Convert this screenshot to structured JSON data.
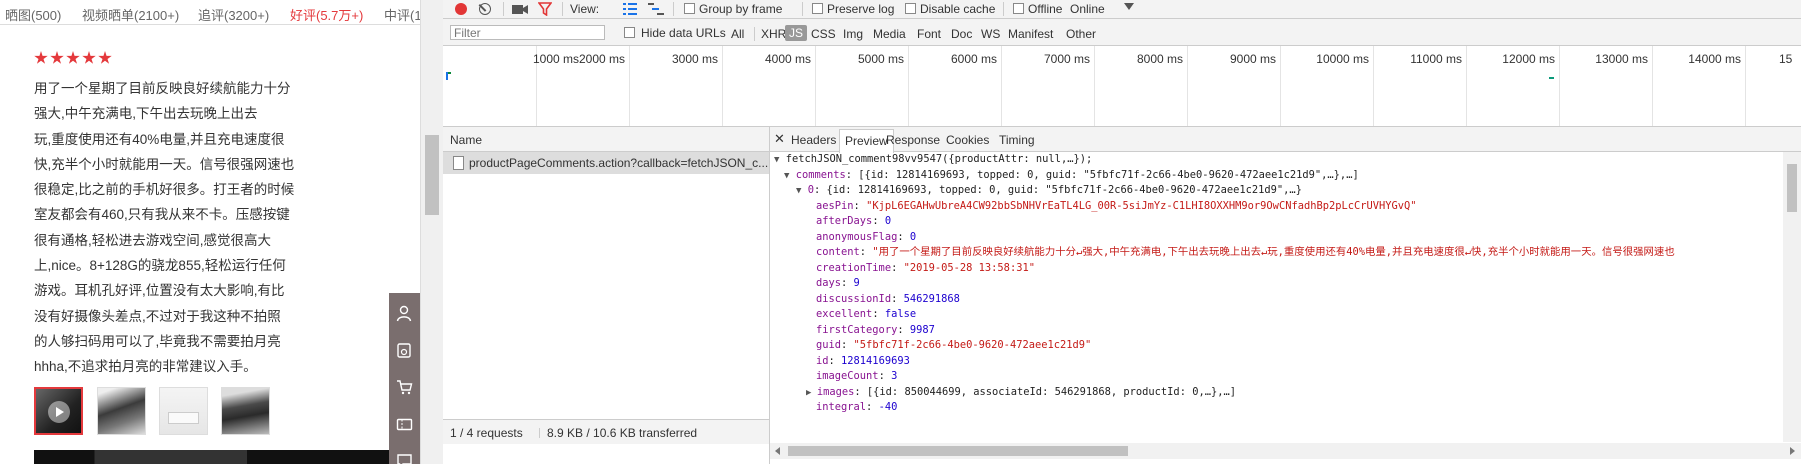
{
  "left_page": {
    "tabs": [
      "晒图(500)",
      "视频晒单(2100+)",
      "追评(3200+)",
      "好评(5.7万+)",
      "中评(1"
    ],
    "rating_stars": 5,
    "review_lines": [
      "用了一个星期了目前反映良好续航能力十分",
      "强大,中午充满电,下午出去玩晚上出去",
      "玩,重度使用还有40%电量,并且充电速度很",
      "快,充半个小时就能用一天。信号很强网速也",
      "很稳定,比之前的手机好很多。打王者的时候",
      "室友都会有460,只有我从来不卡。压感按键",
      "很有通格,轻松进去游戏空间,感觉很高大",
      "上,nice。8+128G的骁龙855,轻松运行任何",
      "游戏。耳机孔好评,位置没有太大影响,有比",
      "没有好摄像头差点,不过对于我这种不拍照",
      "的人够扫码用可以了,毕竟我不需要拍月亮",
      "hhha,不追求拍月亮的非常建议入手。"
    ],
    "colors": {
      "accent": "#e4393c"
    }
  },
  "devtools": {
    "toolbar": {
      "view_label": "View:",
      "group_by_frame": "Group by frame",
      "preserve_log": "Preserve log",
      "disable_cache": "Disable cache",
      "offline": "Offline",
      "throttle": "Online"
    },
    "filter": {
      "placeholder": "Filter",
      "hide_data_urls": "Hide data URLs",
      "types": [
        "All",
        "XHR",
        "JS",
        "CSS",
        "Img",
        "Media",
        "Font",
        "Doc",
        "WS",
        "Manifest",
        "Other"
      ],
      "active_type": "JS"
    },
    "timeline_ticks": [
      "1000 ms",
      "2000 ms",
      "3000 ms",
      "4000 ms",
      "5000 ms",
      "6000 ms",
      "7000 ms",
      "8000 ms",
      "9000 ms",
      "10000 ms",
      "11000 ms",
      "12000 ms",
      "13000 ms",
      "14000 ms",
      "15"
    ],
    "requests": {
      "header": "Name",
      "row_name": "productPageComments.action?callback=fetchJSON_c...",
      "status": "1 / 4 requests",
      "transferred": "8.9 KB / 10.6 KB transferred"
    },
    "preview_tabs": [
      "Headers",
      "Preview",
      "Response",
      "Cookies",
      "Timing"
    ],
    "active_preview_tab": "Preview",
    "json": {
      "line0": "fetchJSON_comment98vv9547({productAttr: null,…});",
      "line1_key": "comments",
      "line1_val": ": [{id: 12814169693, topped: 0, guid: \"5fbfc71f-2c66-4be0-9620-472aee1c21d9\",…},…]",
      "line2_key": "0",
      "line2_val": ": {id: 12814169693, topped: 0, guid: \"5fbfc71f-2c66-4be0-9620-472aee1c21d9\",…}",
      "fields": [
        {
          "k": "aesPin",
          "v": "\"KjpL6EGAHwUbreA4CW92bbSbNHVrEaTL4LG_00R-5siJmYz-C1LHI8OXXHM9or9OwCNfadhBp2pLcCrUVHYGvQ\"",
          "t": "s"
        },
        {
          "k": "afterDays",
          "v": "0",
          "t": "n"
        },
        {
          "k": "anonymousFlag",
          "v": "0",
          "t": "n"
        },
        {
          "k": "content",
          "v": "\"用了一个星期了目前反映良好续航能力十分↵强大,中午充满电,下午出去玩晚上出去↵玩,重度使用还有40%电量,并且充电速度很↵快,充半个小时就能用一天。信号很强网速也",
          "t": "s"
        },
        {
          "k": "creationTime",
          "v": "\"2019-05-28 13:58:31\"",
          "t": "s"
        },
        {
          "k": "days",
          "v": "9",
          "t": "n"
        },
        {
          "k": "discussionId",
          "v": "546291868",
          "t": "n"
        },
        {
          "k": "excellent",
          "v": "false",
          "t": "n"
        },
        {
          "k": "firstCategory",
          "v": "9987",
          "t": "n"
        },
        {
          "k": "guid",
          "v": "\"5fbfc71f-2c66-4be0-9620-472aee1c21d9\"",
          "t": "s"
        },
        {
          "k": "id",
          "v": "12814169693",
          "t": "n"
        },
        {
          "k": "imageCount",
          "v": "3",
          "t": "n"
        },
        {
          "k": "images",
          "v": "[{id: 850044699, associateId: 546291868, productId: 0,…},…]",
          "t": "p",
          "collapsed": true
        },
        {
          "k": "integral",
          "v": "-40",
          "t": "n"
        }
      ]
    }
  }
}
